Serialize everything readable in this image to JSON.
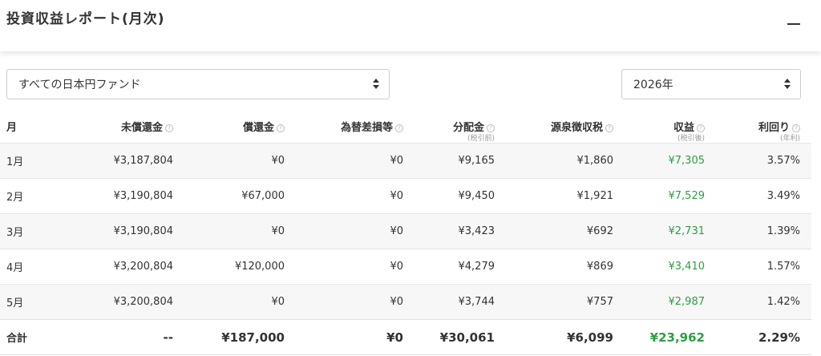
{
  "header": {
    "title": "投資収益レポート(月次)"
  },
  "filters": {
    "fund": "すべての日本円ファンド",
    "year": "2026年"
  },
  "table": {
    "columns": {
      "month": "月",
      "unredeemed": "未償還金",
      "redemption": "償還金",
      "fx": "為替差損等",
      "distribution": "分配金",
      "distribution_sub": "(税引前)",
      "tax": "源泉徴収税",
      "income": "収益",
      "income_sub": "(税引後)",
      "yield": "利回り",
      "yield_sub": "(年利)"
    },
    "rows": [
      {
        "month": "1月",
        "unredeemed": "¥3,187,804",
        "redemption": "¥0",
        "fx": "¥0",
        "distribution": "¥9,165",
        "tax": "¥1,860",
        "income": "¥7,305",
        "yield": "3.57%"
      },
      {
        "month": "2月",
        "unredeemed": "¥3,190,804",
        "redemption": "¥67,000",
        "fx": "¥0",
        "distribution": "¥9,450",
        "tax": "¥1,921",
        "income": "¥7,529",
        "yield": "3.49%"
      },
      {
        "month": "3月",
        "unredeemed": "¥3,190,804",
        "redemption": "¥0",
        "fx": "¥0",
        "distribution": "¥3,423",
        "tax": "¥692",
        "income": "¥2,731",
        "yield": "1.39%"
      },
      {
        "month": "4月",
        "unredeemed": "¥3,200,804",
        "redemption": "¥120,000",
        "fx": "¥0",
        "distribution": "¥4,279",
        "tax": "¥869",
        "income": "¥3,410",
        "yield": "1.57%"
      },
      {
        "month": "5月",
        "unredeemed": "¥3,200,804",
        "redemption": "¥0",
        "fx": "¥0",
        "distribution": "¥3,744",
        "tax": "¥757",
        "income": "¥2,987",
        "yield": "1.42%"
      }
    ],
    "total": {
      "label": "合計",
      "unredeemed": "--",
      "redemption": "¥187,000",
      "fx": "¥0",
      "distribution": "¥30,061",
      "tax": "¥6,099",
      "income": "¥23,962",
      "yield": "2.29%"
    }
  },
  "colors": {
    "income": "#2e9e44"
  }
}
